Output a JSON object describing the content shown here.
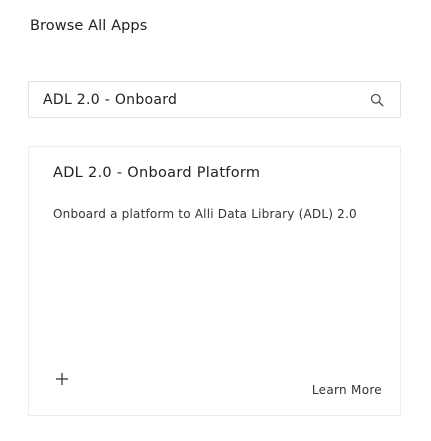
{
  "header": {
    "title": "Browse All Apps"
  },
  "search": {
    "value": "ADL 2.0 - Onboard",
    "icon": "search-icon"
  },
  "card": {
    "title": "ADL 2.0 - Onboard Platform",
    "description": "Onboard a platform to Alli Data Library (ADL) 2.0",
    "add_icon": "plus-icon",
    "learn_more_label": "Learn More"
  }
}
